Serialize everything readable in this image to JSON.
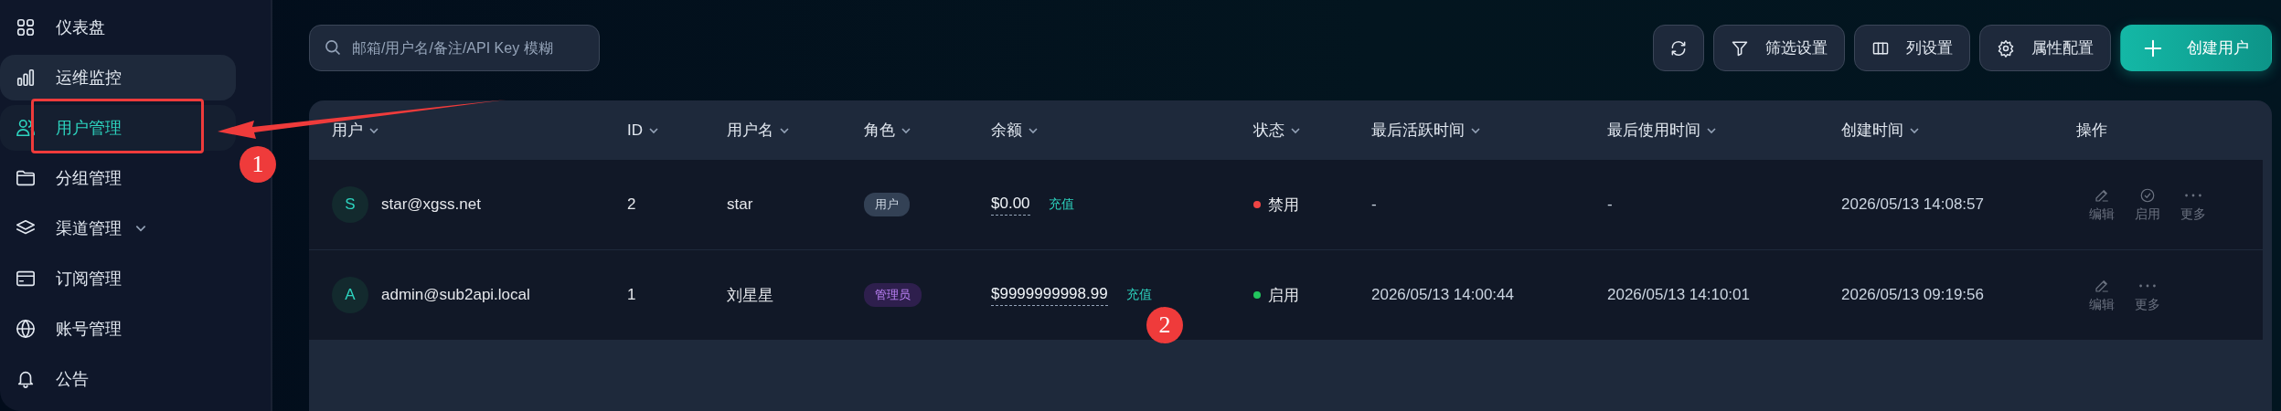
{
  "sidebar": {
    "items": [
      {
        "label": "仪表盘",
        "selected": false,
        "hovered": false,
        "expandable": false
      },
      {
        "label": "运维监控",
        "selected": false,
        "hovered": true,
        "expandable": false
      },
      {
        "label": "用户管理",
        "selected": true,
        "hovered": false,
        "expandable": false
      },
      {
        "label": "分组管理",
        "selected": false,
        "hovered": false,
        "expandable": false
      },
      {
        "label": "渠道管理",
        "selected": false,
        "hovered": false,
        "expandable": true
      },
      {
        "label": "订阅管理",
        "selected": false,
        "hovered": false,
        "expandable": false
      },
      {
        "label": "账号管理",
        "selected": false,
        "hovered": false,
        "expandable": false
      },
      {
        "label": "公告",
        "selected": false,
        "hovered": false,
        "expandable": false
      }
    ]
  },
  "search": {
    "placeholder": "邮箱/用户名/备注/API Key 模糊"
  },
  "toolbar": [
    {
      "kind": "refresh"
    },
    {
      "kind": "filter",
      "label": "筛选设置"
    },
    {
      "kind": "columns",
      "label": "列设置"
    },
    {
      "kind": "settings",
      "label": "属性配置"
    },
    {
      "kind": "create",
      "label": "创建用户"
    }
  ],
  "table": {
    "columns": [
      {
        "label": "用户",
        "sortable": true
      },
      {
        "label": "ID",
        "sortable": true
      },
      {
        "label": "用户名",
        "sortable": true
      },
      {
        "label": "角色",
        "sortable": true
      },
      {
        "label": "余额",
        "sortable": true
      },
      {
        "label": "状态",
        "sortable": true
      },
      {
        "label": "最后活跃时间",
        "sortable": true
      },
      {
        "label": "最后使用时间",
        "sortable": true
      },
      {
        "label": "创建时间",
        "sortable": true
      },
      {
        "label": "操作",
        "sortable": false
      }
    ],
    "rows": [
      {
        "avatar": "S",
        "email": "star@xgss.net",
        "id": "2",
        "username": "star",
        "role": {
          "kind": "user",
          "label": "用户"
        },
        "balance": "$0.00",
        "recharge": "充值",
        "status": {
          "enabled": false,
          "label": "禁用"
        },
        "last_active": "-",
        "last_used": "-",
        "created": "2026/05/13 14:08:57",
        "actions": [
          {
            "kind": "edit",
            "label": "编辑"
          },
          {
            "kind": "enable",
            "label": "启用"
          },
          {
            "kind": "more",
            "label": "更多"
          }
        ]
      },
      {
        "avatar": "A",
        "email": "admin@sub2api.local",
        "id": "1",
        "username": "刘星星",
        "role": {
          "kind": "admin",
          "label": "管理员"
        },
        "balance": "$9999999998.99",
        "recharge": "充值",
        "status": {
          "enabled": true,
          "label": "启用"
        },
        "last_active": "2026/05/13 14:00:44",
        "last_used": "2026/05/13 14:10:01",
        "created": "2026/05/13 09:19:56",
        "actions": [
          {
            "kind": "edit",
            "label": "编辑"
          },
          {
            "kind": "more",
            "label": "更多"
          }
        ]
      }
    ]
  },
  "annotations": [
    {
      "label": "1"
    },
    {
      "label": "2"
    }
  ]
}
